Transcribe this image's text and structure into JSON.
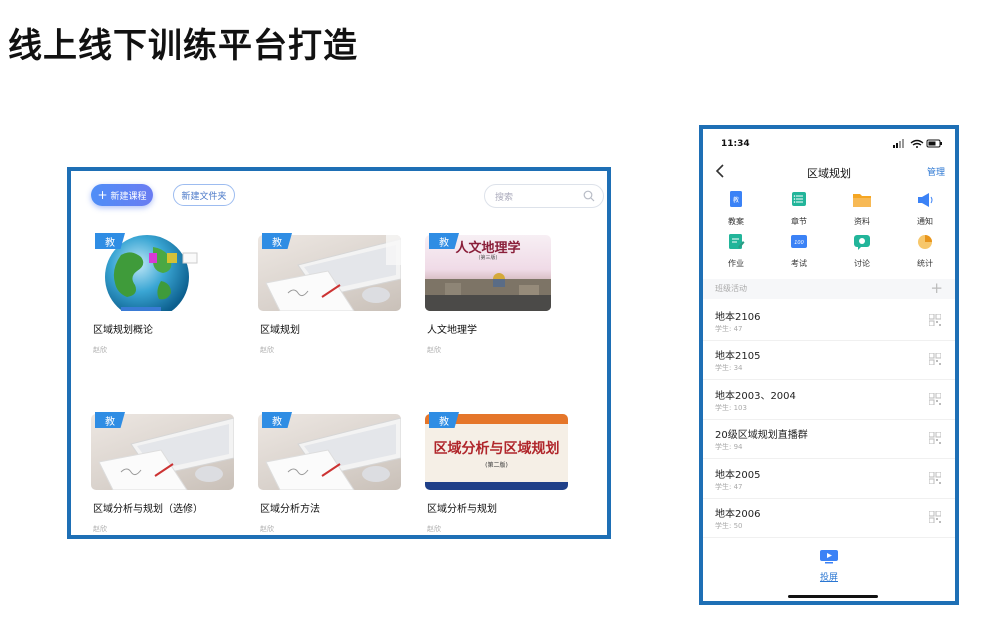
{
  "slide": {
    "title": "线上线下训练平台打造"
  },
  "library": {
    "new_course_label": "新建课程",
    "new_folder_label": "新建文件夹",
    "search_placeholder": "搜索",
    "badge_label": "教",
    "courses": [
      {
        "title": "区域规划概论",
        "author": "赵欣",
        "thumb": "globe"
      },
      {
        "title": "区域规划",
        "author": "赵欣",
        "thumb": "desk"
      },
      {
        "title": "人文地理学",
        "author": "赵欣",
        "thumb": "book-human-geo",
        "cover_title": "人文地理学",
        "cover_edition": "(第三版)"
      },
      {
        "title": "区域分析与规划（选修）",
        "author": "赵欣",
        "thumb": "desk"
      },
      {
        "title": "区域分析方法",
        "author": "赵欣",
        "thumb": "desk"
      },
      {
        "title": "区域分析与规划",
        "author": "赵欣",
        "thumb": "book-regional",
        "cover_title": "区域分析与区域规划",
        "cover_edition": "(第二版)"
      }
    ]
  },
  "phone": {
    "status_time": "11:34",
    "nav_title": "区域规划",
    "manage_label": "管理",
    "functions": [
      {
        "label": "教案",
        "icon": "lesson-plan-icon",
        "color": "#3b82f6"
      },
      {
        "label": "章节",
        "icon": "chapter-icon",
        "color": "#22b59a"
      },
      {
        "label": "资料",
        "icon": "folder-icon",
        "color": "#f5a623"
      },
      {
        "label": "通知",
        "icon": "megaphone-icon",
        "color": "#3b82f6"
      },
      {
        "label": "作业",
        "icon": "homework-icon",
        "color": "#22b59a"
      },
      {
        "label": "考试",
        "icon": "exam-icon",
        "color": "#3b82f6"
      },
      {
        "label": "讨论",
        "icon": "discussion-icon",
        "color": "#22b59a"
      },
      {
        "label": "统计",
        "icon": "statistics-icon",
        "color": "#f5a623"
      }
    ],
    "section_label": "班级活动",
    "classes": [
      {
        "name": "地本2106",
        "students": "学生: 47"
      },
      {
        "name": "地本2105",
        "students": "学生: 34"
      },
      {
        "name": "地本2003、2004",
        "students": "学生: 103"
      },
      {
        "name": "20级区域规划直播群",
        "students": "学生: 94"
      },
      {
        "name": "地本2005",
        "students": "学生: 47"
      },
      {
        "name": "地本2006",
        "students": "学生: 50"
      }
    ],
    "cast_label": "投屏"
  }
}
